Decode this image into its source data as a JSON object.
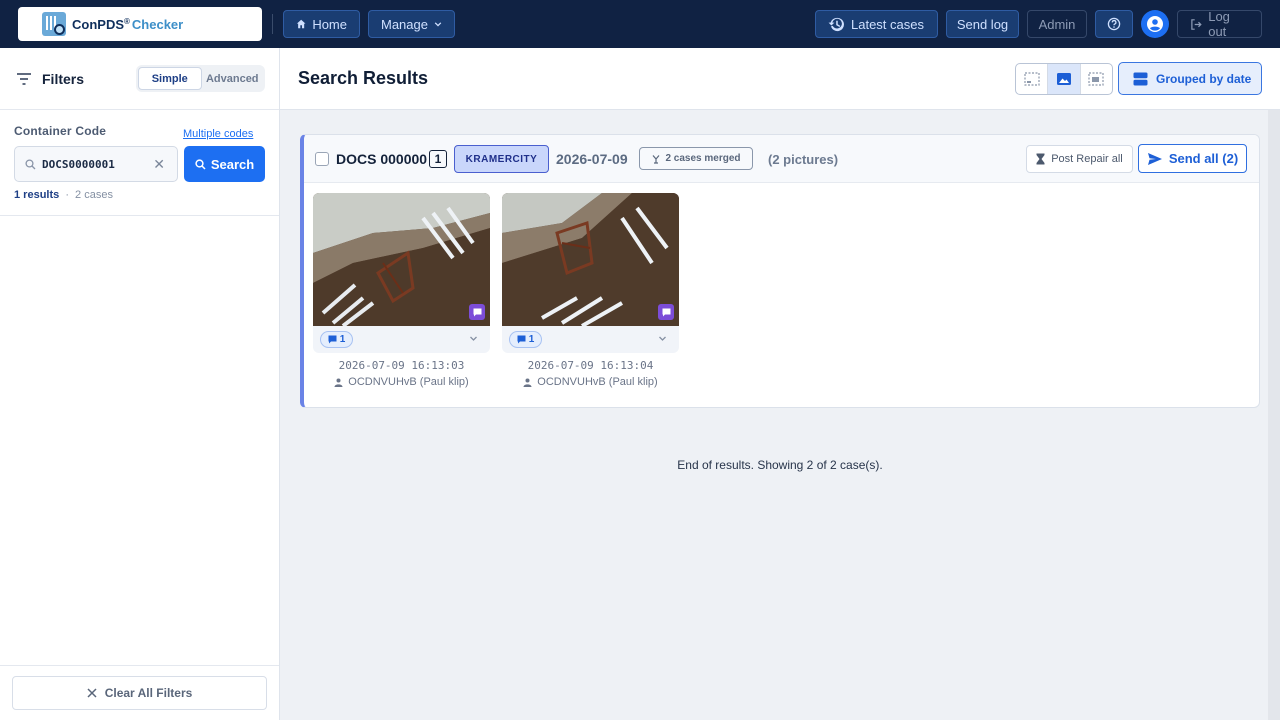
{
  "app": {
    "name": "ConPDS",
    "reg": "®",
    "product": "Checker"
  },
  "nav": {
    "home": "Home",
    "manage": "Manage",
    "latest_cases": "Latest cases",
    "send_log": "Send log",
    "admin": "Admin",
    "logout": "Log out"
  },
  "sidebar": {
    "title": "Filters",
    "modes": [
      "Simple",
      "Advanced"
    ],
    "active_mode": "Simple",
    "container_code_label": "Container Code",
    "multiple_codes_link": "Multiple codes",
    "search_value": "DOCS0000001",
    "search_button": "Search",
    "results_count": "1 results",
    "results_sep": "·",
    "cases_count": "2 cases",
    "clear_all": "Clear All Filters"
  },
  "main": {
    "title": "Search Results",
    "grouped_button": "Grouped by date"
  },
  "case": {
    "code_prefix": "DOCS 000000",
    "code_digit": "1",
    "city": "KRAMERCITY",
    "date": "2026-07-09",
    "merged": "2 cases merged",
    "pictures": "(2 pictures)",
    "post_repair": "Post Repair all",
    "send_all": "Send all (2)",
    "photos": [
      {
        "comments": "1",
        "timestamp": "2026-07-09 16:13:03",
        "user": "OCDNVUHvB (Paul klip)"
      },
      {
        "comments": "1",
        "timestamp": "2026-07-09 16:13:04",
        "user": "OCDNVUHvB (Paul klip)"
      }
    ]
  },
  "footer_text": "End of results. Showing 2 of 2 case(s).",
  "colors": {
    "topbar": "#102243",
    "accent": "#1d6ff2",
    "badge": "#c9d6fb",
    "comment": "#7c4dd8"
  }
}
